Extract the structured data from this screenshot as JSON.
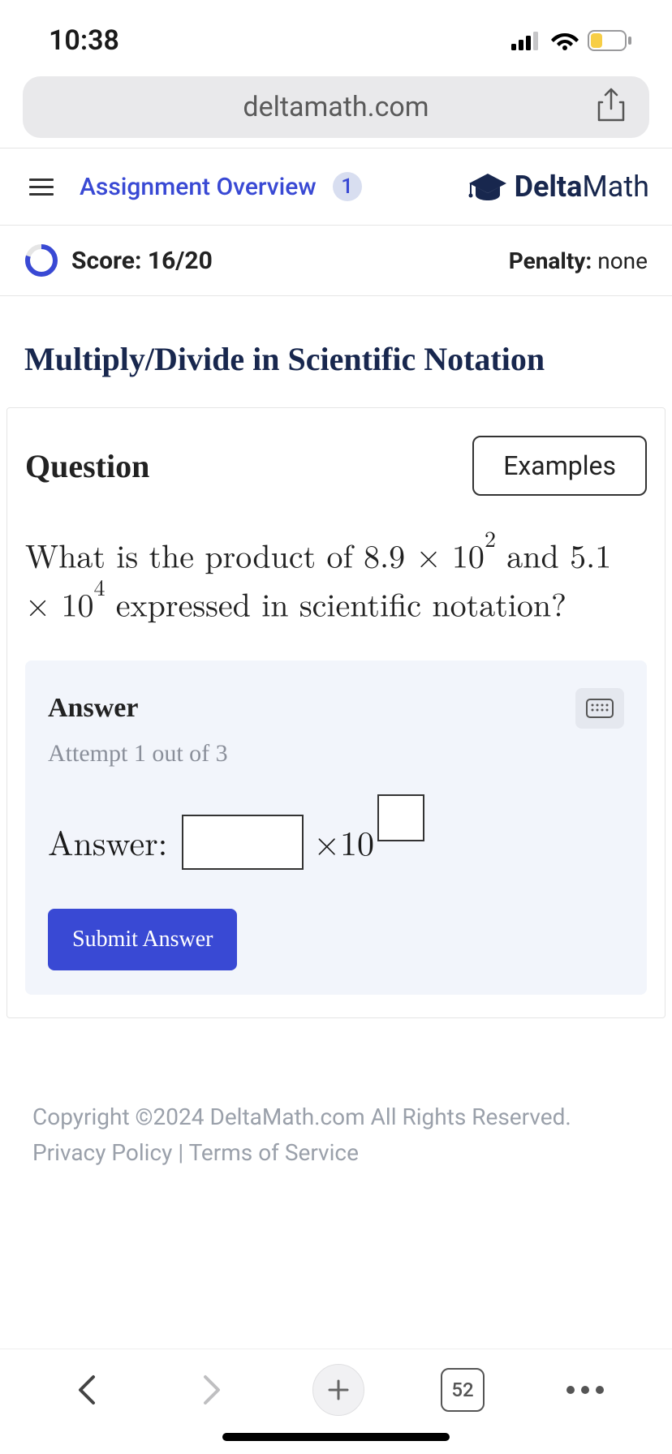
{
  "status": {
    "time": "10:38"
  },
  "browser": {
    "url": "deltamath.com",
    "tab_count": "52"
  },
  "header": {
    "overview_link": "Assignment Overview",
    "overview_badge": "1",
    "logo_bold": "Delta",
    "logo_thin": "Math"
  },
  "score": {
    "label": "Score: 16/20",
    "penalty_label": "Penalty:",
    "penalty_value": "none"
  },
  "topic": "Multiply/Divide in Scientific Notation",
  "question": {
    "heading": "Question",
    "examples_btn": "Examples",
    "text_parts": {
      "p1": "What is the product of ",
      "num1": "8.9 × 10",
      "exp1": "2",
      "mid": " and ",
      "num2": "5.1 × 10",
      "exp2": "4",
      "p2": " expressed in scientific notation?"
    }
  },
  "answer": {
    "label": "Answer",
    "attempt": "Attempt 1 out of 3",
    "prefix": "Answer:",
    "times_ten": "×10",
    "submit": "Submit Answer"
  },
  "footer": {
    "copyright": "Copyright ©2024 DeltaMath.com All Rights Reserved.",
    "privacy": "Privacy Policy",
    "sep": " | ",
    "terms": "Terms of Service"
  }
}
